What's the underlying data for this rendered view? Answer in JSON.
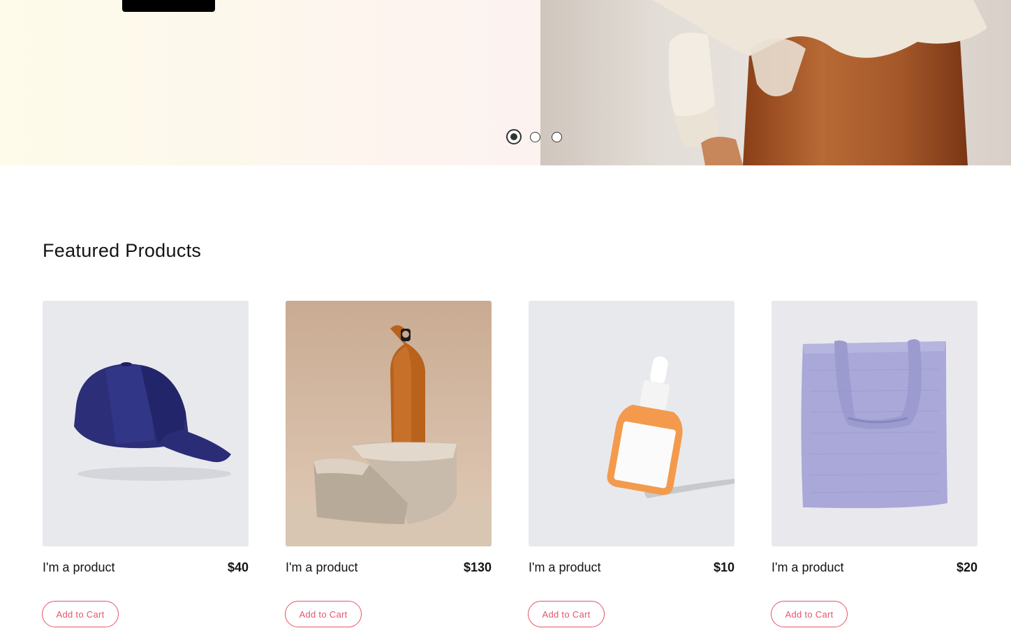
{
  "hero": {
    "carousel_dots": [
      "slide-1",
      "slide-2",
      "slide-3"
    ],
    "active_slide": 1
  },
  "featured": {
    "title": "Featured Products",
    "products": [
      {
        "name": "I'm a product",
        "price": "$40",
        "cart_label": "Add to Cart",
        "image": "navy-baseball-cap"
      },
      {
        "name": "I'm a product",
        "price": "$130",
        "cart_label": "Add to Cart",
        "image": "copper-water-bottle-on-stone"
      },
      {
        "name": "I'm a product",
        "price": "$10",
        "cart_label": "Add to Cart",
        "image": "orange-serum-dropper-bottle"
      },
      {
        "name": "I'm a product",
        "price": "$20",
        "cart_label": "Add to Cart",
        "image": "lavender-tote-bag"
      }
    ]
  },
  "colors": {
    "accent": "#e8546a",
    "text": "#141414",
    "image_bg": "#e8e9ec"
  }
}
